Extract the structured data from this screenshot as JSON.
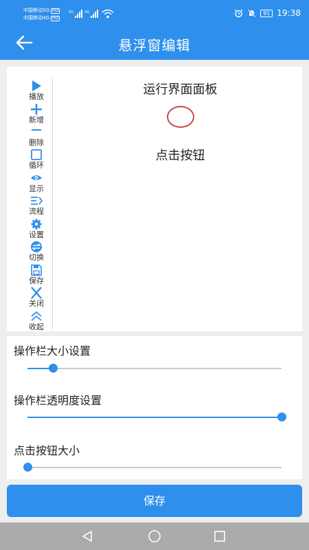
{
  "status_bar": {
    "carrier_line1": "中国移动5G",
    "carrier_line2": "中国移动4G",
    "hd_badge": "HD",
    "net1": "5G",
    "net2": "4G",
    "battery": "91",
    "time": "19:38"
  },
  "header": {
    "title": "悬浮窗编辑"
  },
  "toolbar": {
    "items": [
      {
        "label": "播放",
        "icon": "play-icon"
      },
      {
        "label": "新增",
        "icon": "plus-icon"
      },
      {
        "label": "删除",
        "icon": "minus-icon"
      },
      {
        "label": "循环",
        "icon": "square-icon"
      },
      {
        "label": "显示",
        "icon": "eye-icon"
      },
      {
        "label": "流程",
        "icon": "flow-icon"
      },
      {
        "label": "设置",
        "icon": "gear-icon"
      },
      {
        "label": "切换",
        "icon": "switch-icon"
      },
      {
        "label": "保存",
        "icon": "save-icon"
      },
      {
        "label": "关闭",
        "icon": "close-icon"
      },
      {
        "label": "收起",
        "icon": "collapse-icon"
      }
    ]
  },
  "preview": {
    "panel_title": "运行界面面板",
    "button_label": "点击按钮"
  },
  "settings": {
    "toolbar_size": {
      "label": "操作栏大小设置",
      "value": 0.1
    },
    "toolbar_opacity": {
      "label": "操作栏透明度设置",
      "value": 1.0
    },
    "button_size": {
      "label": "点击按钮大小",
      "value": 0.0
    }
  },
  "save_button": "保存",
  "colors": {
    "accent": "#2f8fec",
    "circle": "#c64a4a"
  }
}
